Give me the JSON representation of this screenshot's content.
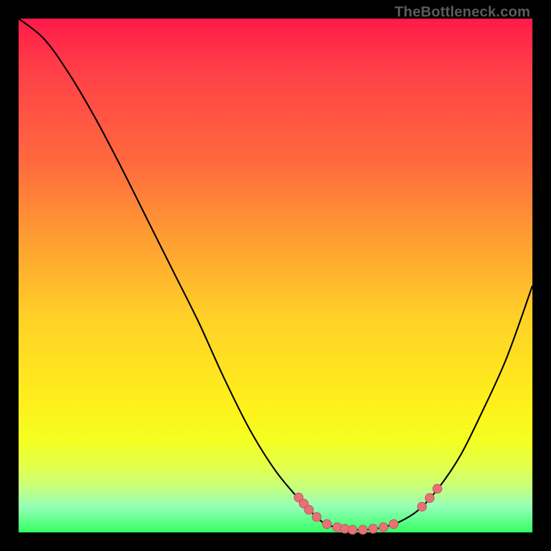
{
  "watermark": "TheBottleneck.com",
  "colors": {
    "background": "#000000",
    "curve": "#000000",
    "marker_fill": "#e87077",
    "marker_stroke": "#bc575e"
  },
  "chart_data": {
    "type": "line",
    "title": "",
    "xlabel": "",
    "ylabel": "",
    "xlim": [
      0,
      100
    ],
    "ylim": [
      0,
      100
    ],
    "series": [
      {
        "name": "bottleneck-curve",
        "x": [
          0,
          5,
          10,
          15,
          20,
          25,
          30,
          35,
          40,
          45,
          50,
          55,
          58,
          60,
          63,
          66,
          70,
          74,
          78,
          82,
          86,
          90,
          95,
          100
        ],
        "y": [
          100,
          96,
          89,
          80.5,
          71,
          61,
          51,
          41,
          30,
          20,
          12,
          6,
          3,
          1.5,
          0.8,
          0.5,
          0.8,
          2,
          4.5,
          9,
          15,
          23,
          34,
          48
        ]
      }
    ],
    "markers": [
      {
        "x": 54.5,
        "y": 6.8
      },
      {
        "x": 55.5,
        "y": 5.6
      },
      {
        "x": 56.5,
        "y": 4.4
      },
      {
        "x": 58.0,
        "y": 3.0
      },
      {
        "x": 60.0,
        "y": 1.6
      },
      {
        "x": 62.0,
        "y": 1.0
      },
      {
        "x": 63.5,
        "y": 0.7
      },
      {
        "x": 65.0,
        "y": 0.5
      },
      {
        "x": 67.0,
        "y": 0.5
      },
      {
        "x": 69.0,
        "y": 0.7
      },
      {
        "x": 71.0,
        "y": 1.0
      },
      {
        "x": 73.0,
        "y": 1.6
      },
      {
        "x": 78.5,
        "y": 5.0
      },
      {
        "x": 80.0,
        "y": 6.7
      },
      {
        "x": 81.5,
        "y": 8.5
      }
    ]
  }
}
